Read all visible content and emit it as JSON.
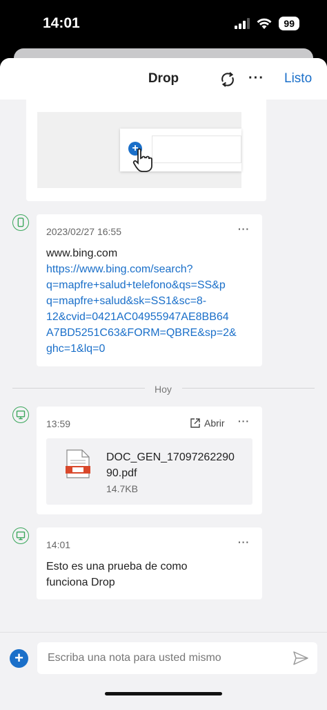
{
  "status_bar": {
    "time": "14:01",
    "battery": "99"
  },
  "header": {
    "title": "Drop",
    "done_label": "Listo"
  },
  "divider": {
    "label": "Hoy"
  },
  "messages": [
    {
      "timestamp": "2023/02/27 16:55",
      "line1": "www.bing.com",
      "link": "https://www.bing.com/search?q=mapfre+salud+telefono&qs=SS&pq=mapfre+salud&sk=SS1&sc=8-12&cvid=0421AC04955947AE8BB64A7BD5251C63&FORM=QBRE&sp=2&ghc=1&lq=0",
      "link_lines": [
        "https://www.bing.com/search?",
        "q=mapfre+salud+telefono&qs=SS&p",
        "q=mapfre+salud&sk=SS1&sc=8-",
        "12&cvid=0421AC04955947AE8BB64",
        "A7BD5251C63&FORM=QBRE&sp=2&",
        "ghc=1&lq=0"
      ]
    },
    {
      "timestamp": "13:59",
      "open_label": "Abrir",
      "file_name_lines": [
        "DOC_GEN_17097262290",
        "90.pdf"
      ],
      "file_size": "14.7KB"
    },
    {
      "timestamp": "14:01",
      "text_lines": [
        "Esto es una prueba de como",
        "funciona Drop"
      ]
    }
  ],
  "composer": {
    "placeholder": "Escriba una nota para usted mismo"
  },
  "colors": {
    "accent": "#1a6fc9",
    "device_green": "#39a65a",
    "background": "#f2f2f4"
  },
  "icons": [
    "sync-icon",
    "more-icon",
    "phone-icon",
    "pc-icon",
    "open-external-icon",
    "pdf-file-icon",
    "add-icon",
    "send-icon",
    "pointer-hand-icon"
  ]
}
